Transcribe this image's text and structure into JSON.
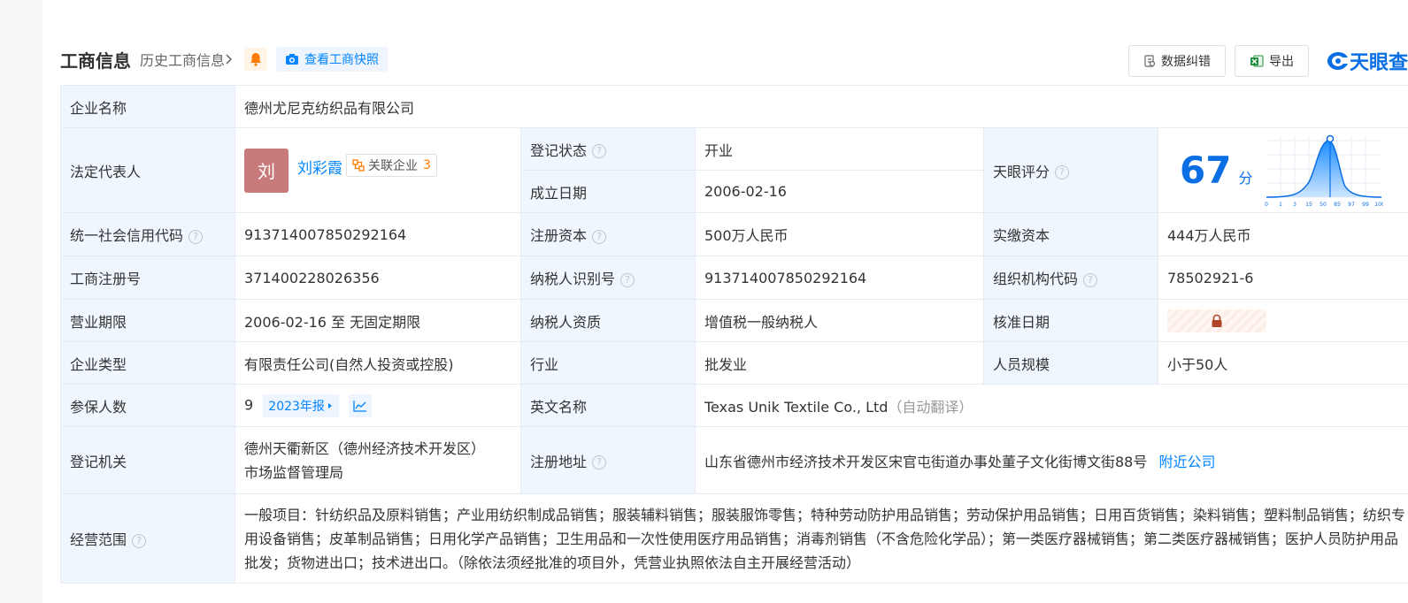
{
  "header": {
    "title": "工商信息",
    "history_label": "历史工商信息",
    "snapshot_label": "查看工商快照",
    "correct_label": "数据纠错",
    "export_label": "导出",
    "logo_text": "天眼查"
  },
  "labels": {
    "company_name": "企业名称",
    "legal_rep": "法定代表人",
    "reg_status": "登记状态",
    "found_date": "成立日期",
    "tianyan_score": "天眼评分",
    "credit_code": "统一社会信用代码",
    "reg_capital": "注册资本",
    "paid_capital": "实缴资本",
    "biz_reg_no": "工商注册号",
    "taxpayer_id": "纳税人识别号",
    "org_code": "组织机构代码",
    "biz_term": "营业期限",
    "taxpayer_qual": "纳税人资质",
    "approve_date": "核准日期",
    "company_type": "企业类型",
    "industry": "行业",
    "staff_size": "人员规模",
    "insured": "参保人数",
    "english_name": "英文名称",
    "reg_authority": "登记机关",
    "reg_address": "注册地址",
    "biz_scope": "经营范围"
  },
  "values": {
    "company_name": "德州尤尼克纺织品有限公司",
    "legal_avatar": "刘",
    "legal_name": "刘彩霞",
    "related_label": "关联企业",
    "related_count": "3",
    "reg_status": "开业",
    "found_date": "2006-02-16",
    "score": "67",
    "score_unit": "分",
    "credit_code": "913714007850292164",
    "reg_capital": "500万人民币",
    "paid_capital": "444万人民币",
    "biz_reg_no": "371400228026356",
    "taxpayer_id": "913714007850292164",
    "org_code": "78502921-6",
    "biz_term": "2006-02-16 至 无固定期限",
    "taxpayer_qual": "增值税一般纳税人",
    "company_type": "有限责任公司(自然人投资或控股)",
    "industry": "批发业",
    "staff_size": "小于50人",
    "insured": "9",
    "report_label": "2023年报",
    "english_name": "Texas Unik Textile Co., Ltd",
    "english_note": "（自动翻译）",
    "reg_authority_line1": "德州天衢新区（德州经济技术开发区）",
    "reg_authority_line2": "市场监督管理局",
    "reg_address": "山东省德州市经济技术开发区宋官屯街道办事处董子文化街博文街88号",
    "nearby_label": "附近公司",
    "biz_scope": "一般项目：针纺织品及原料销售；产业用纺织制成品销售；服装辅料销售；服装服饰零售；特种劳动防护用品销售；劳动保护用品销售；日用百货销售；染料销售；塑料制品销售；纺织专用设备销售；皮革制品销售；日用化学产品销售；卫生用品和一次性使用医疗用品销售；消毒剂销售（不含危险化学品）；第一类医疗器械销售；第二类医疗器械销售；医护人员防护用品批发；货物进出口；技术进出口。（除依法须经批准的项目外，凭营业执照依法自主开展经营活动）"
  },
  "score_chart": {
    "ticks": [
      "0",
      "1",
      "3",
      "15",
      "50",
      "85",
      "97",
      "99",
      "100"
    ],
    "marker_value": 67
  },
  "colors": {
    "accent": "#0084ff",
    "status_green": "#00a854",
    "label_bg": "#eff6fd",
    "avatar_bg": "#c97a7a",
    "warning": "#ff7a00"
  },
  "icons": {
    "bell": "bell-icon",
    "camera": "camera-icon",
    "correct": "edit-doc-icon",
    "export": "excel-icon",
    "lock": "lock-icon",
    "trend": "trend-chart-icon",
    "help": "question-icon",
    "related": "relation-icon"
  }
}
